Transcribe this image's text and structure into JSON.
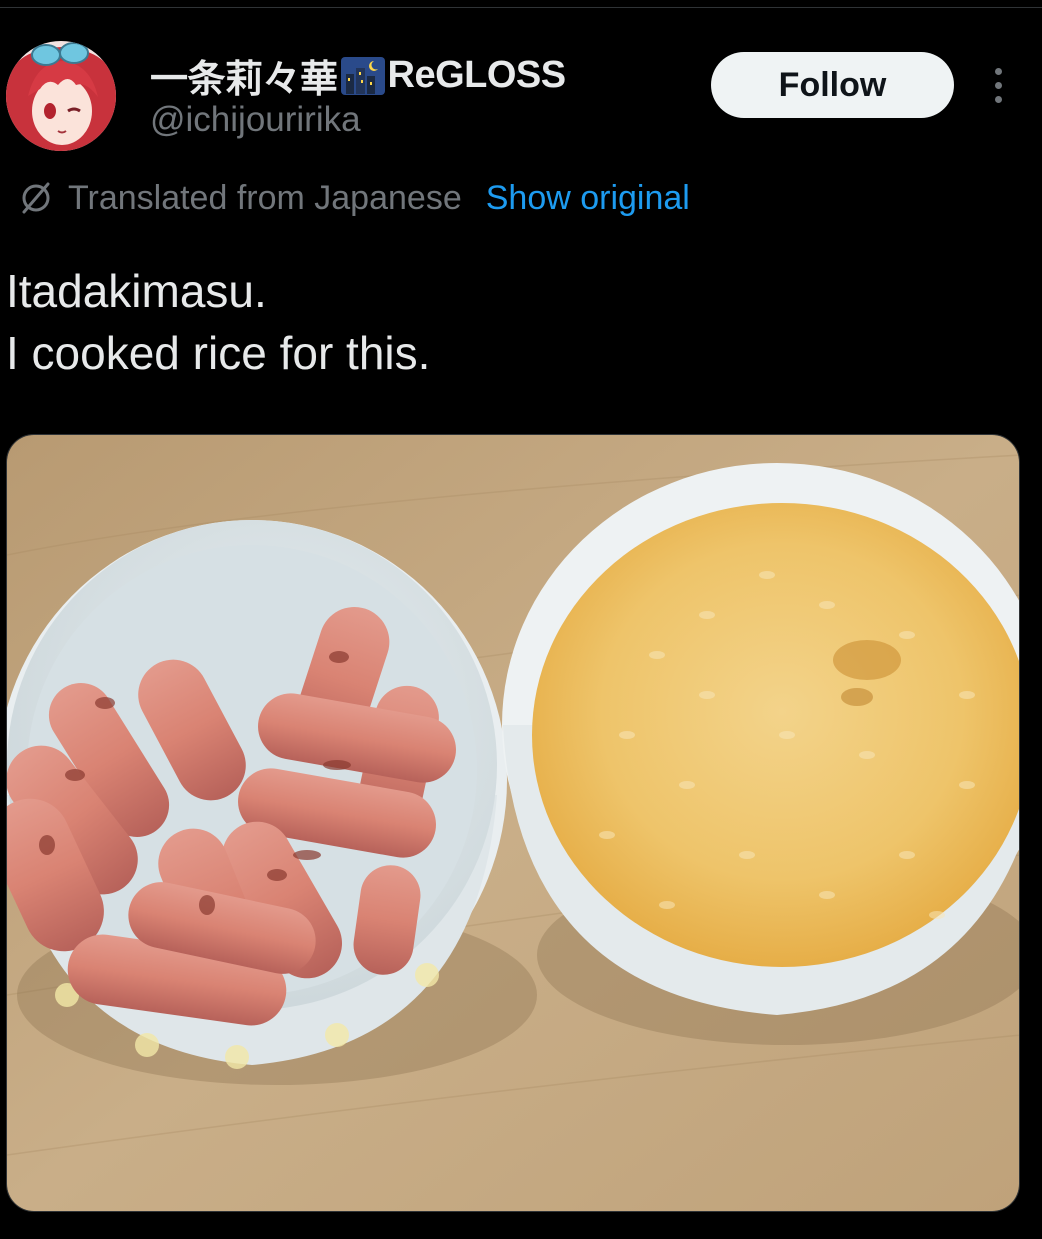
{
  "author": {
    "display_name": "一条莉々華",
    "name_suffix": "ReGLOSS",
    "handle": "@ichijouririka"
  },
  "actions": {
    "follow_label": "Follow"
  },
  "translation": {
    "label": "Translated from Japanese",
    "show_original_label": "Show original"
  },
  "tweet": {
    "lines": [
      "Itadakimasu.",
      "I cooked rice for this."
    ]
  },
  "colors": {
    "background": "#000000",
    "text_primary": "#e7e9ea",
    "text_secondary": "#71767b",
    "link": "#1d9bf0",
    "follow_bg": "#eff3f4"
  },
  "icons": {
    "more": "more-options-icon",
    "translate": "translate-icon",
    "name_emoji": "night-city-emoji"
  }
}
